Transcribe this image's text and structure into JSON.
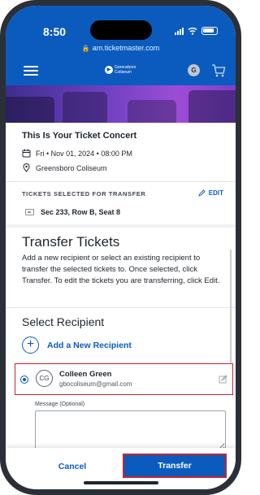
{
  "status_bar": {
    "time": "8:50"
  },
  "url": "am.ticketmaster.com",
  "header": {
    "logo_text": "Greensboro Coliseum",
    "avatar_initial": "G"
  },
  "event": {
    "title": "This Is Your Ticket Concert",
    "date": "Fri • Nov 01, 2024 • 08:00 PM",
    "venue": "Greensboro Coliseum"
  },
  "tickets": {
    "section_label": "TICKETS SELECTED FOR TRANSFER",
    "edit_label": "EDIT",
    "seat": "Sec 233, Row B, Seat 8"
  },
  "transfer": {
    "title": "Transfer Tickets",
    "description": "Add a new recipient or select an existing recipient to transfer the selected tickets to. Once selected, click Transfer. To edit the tickets you are transferring, click Edit."
  },
  "recipients": {
    "title": "Select Recipient",
    "add_label": "Add a New Recipient",
    "selected": {
      "initials": "CG",
      "name": "Colleen Green",
      "email": "gbocoliseum@gmail.com"
    }
  },
  "message": {
    "label": "Message (Optional)",
    "value": ""
  },
  "actions": {
    "cancel_label": "Cancel",
    "transfer_label": "Transfer"
  },
  "colors": {
    "brand_blue": "#0b5bbf",
    "highlight_red": "#c8232c"
  }
}
